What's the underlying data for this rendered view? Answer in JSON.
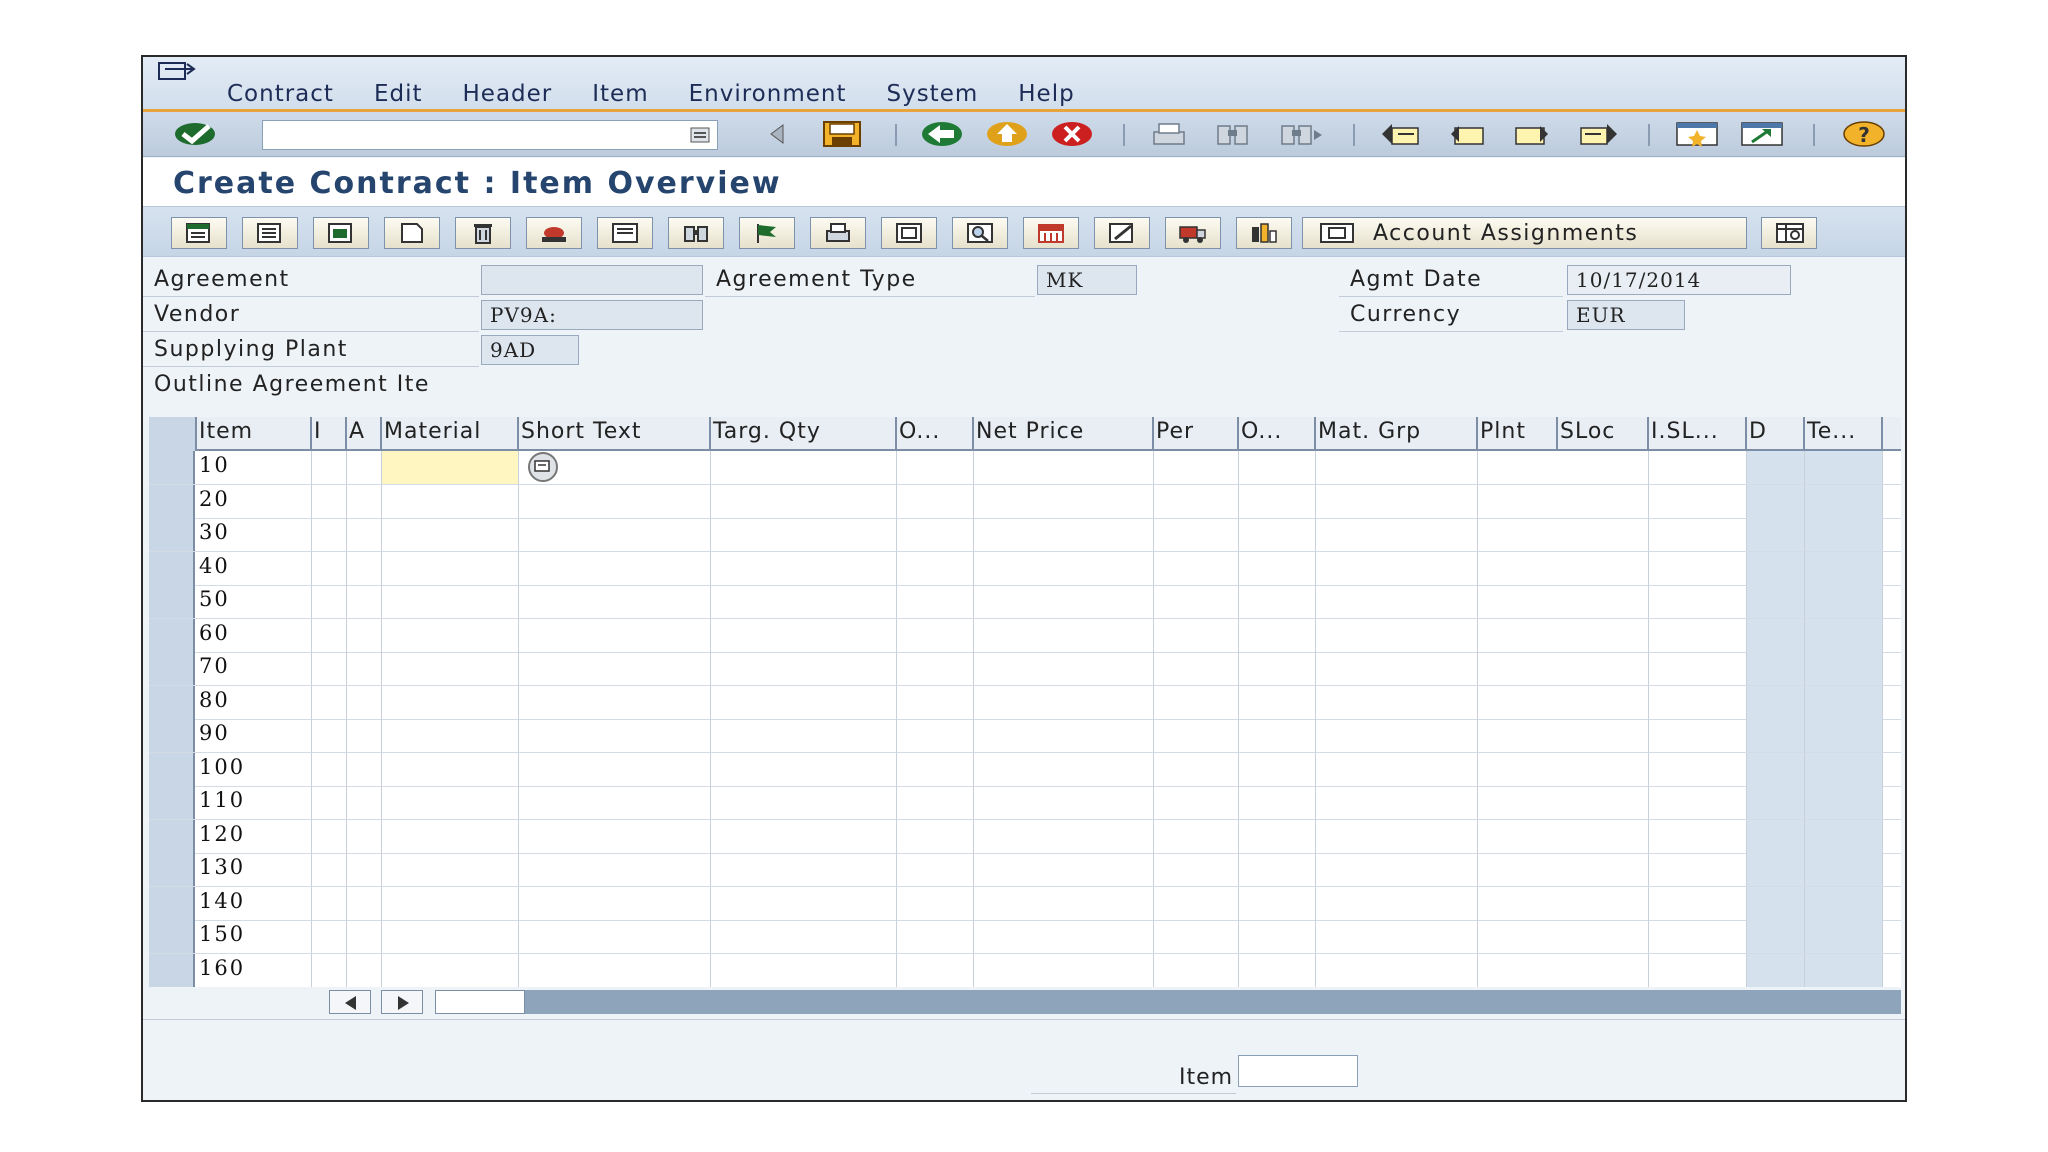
{
  "menu": [
    "Contract",
    "Edit",
    "Header",
    "Item",
    "Environment",
    "System",
    "Help"
  ],
  "toolbar": {
    "command_value": "",
    "icons": [
      "enter-check-icon",
      "command-dropdown-icon",
      "back-triangle-icon",
      "save-icon",
      "back-icon",
      "exit-icon",
      "cancel-icon",
      "print-icon",
      "find-icon",
      "find-next-icon",
      "first-page-icon",
      "previous-page-icon",
      "next-page-icon",
      "last-page-icon",
      "new-session-icon",
      "shortcut-icon",
      "help-icon"
    ]
  },
  "title": "Create Contract : Item Overview",
  "app_toolbar": {
    "account_assignments_label": "Account Assignments"
  },
  "header": {
    "agreement_label": "Agreement",
    "agreement_value": "",
    "agreement_type_label": "Agreement Type",
    "agreement_type_value": "MK",
    "agmt_date_label": "Agmt Date",
    "agmt_date_value": "10/17/2014",
    "vendor_label": "Vendor",
    "vendor_value": "PV9A:",
    "currency_label": "Currency",
    "currency_value": "EUR",
    "supplying_plant_label": "Supplying Plant",
    "supplying_plant_value": "9AD",
    "outline_label": "Outline Agreement Ite"
  },
  "table": {
    "columns": [
      "Item",
      "I",
      "A",
      "Material",
      "Short Text",
      "Targ. Qty",
      "O...",
      "Net Price",
      "Per",
      "O...",
      "Mat. Grp",
      "Plnt",
      "SLoc",
      "I.SL...",
      "D",
      "Te..."
    ],
    "rows": [
      "10",
      "20",
      "30",
      "40",
      "50",
      "60",
      "70",
      "80",
      "90",
      "100",
      "110",
      "120",
      "130",
      "140",
      "150",
      "160"
    ]
  },
  "footer": {
    "item_label": "Item",
    "item_value": ""
  },
  "colors": {
    "accent_orange": "#e8a33c",
    "title_blue": "#25446e",
    "edit_cell_yellow": "#fff6c2"
  }
}
